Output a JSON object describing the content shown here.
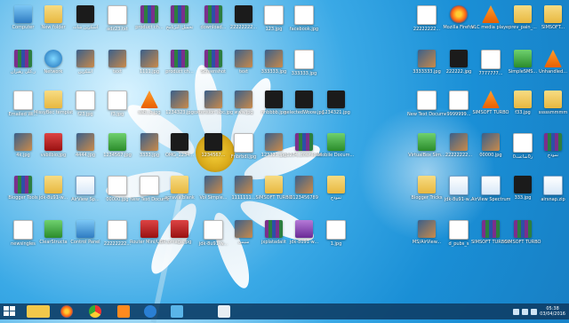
{
  "desktop": {
    "icons": [
      {
        "label": "Computer",
        "type": "t-pc"
      },
      {
        "label": "New folder",
        "type": "t-folder"
      },
      {
        "label": "اسکرین شات",
        "type": "t-dark"
      },
      {
        "label": "adz23.txt",
        "type": "t-txt"
      },
      {
        "label": "product ch...",
        "type": "t-rar"
      },
      {
        "label": "تحميل البرنامج",
        "type": "t-rar"
      },
      {
        "label": "download...",
        "type": "t-rar"
      },
      {
        "label": "22222222...",
        "type": "t-dark"
      },
      {
        "label": "123.jpg",
        "type": "t-txt"
      },
      {
        "label": "facebook.jpg",
        "type": "t-txt"
      },
      {
        "label": "22222222...",
        "type": "t-txt"
      },
      {
        "label": "Mozilla Firefox",
        "type": "t-ff"
      },
      {
        "label": "VLC media player",
        "type": "t-vlc"
      },
      {
        "label": "prev_pain_...",
        "type": "t-folder"
      },
      {
        "label": "SIMSOFT...",
        "type": "t-folder"
      },
      {
        "label": "ر.کلی رهبران",
        "type": "t-rar"
      },
      {
        "label": "Network",
        "type": "t-net"
      },
      {
        "label": "اسکرین",
        "type": "t-img"
      },
      {
        "label": "text",
        "type": "t-img"
      },
      {
        "label": "1111.jpg",
        "type": "t-img"
      },
      {
        "label": "product ch...",
        "type": "t-rar"
      },
      {
        "label": "Screenshot",
        "type": "t-rar"
      },
      {
        "label": "text",
        "type": "t-img"
      },
      {
        "label": "333333.jpg",
        "type": "t-img"
      },
      {
        "label": "333333.jpg",
        "type": "t-txt"
      },
      {
        "label": "3333333.jpg",
        "type": "t-img"
      },
      {
        "label": "222222.jpg",
        "type": "t-dark"
      },
      {
        "label": "7777777...",
        "type": "t-txt"
      },
      {
        "label": "SimpleSMS...",
        "type": "t-green"
      },
      {
        "label": "Unhandled...",
        "type": "t-vlc"
      },
      {
        "label": "Emailed Wi...",
        "type": "t-txt"
      },
      {
        "label": "MissyBec template",
        "type": "t-folder"
      },
      {
        "label": "f23.jpg",
        "type": "t-txt"
      },
      {
        "label": "f3.jpg",
        "type": "t-txt"
      },
      {
        "label": "sabi_b.jpg",
        "type": "t-vlc"
      },
      {
        "label": "1234323.jpg",
        "type": "t-img"
      },
      {
        "label": "oxtension abc.jpg",
        "type": "t-img"
      },
      {
        "label": "www.jpg",
        "type": "t-img"
      },
      {
        "label": "nnbbbb.jpg",
        "type": "t-dark"
      },
      {
        "label": "selectedWoow.jpg",
        "type": "t-dark"
      },
      {
        "label": "1234321.jpg",
        "type": "t-dark"
      },
      {
        "label": "New Text Document...",
        "type": "t-txt"
      },
      {
        "label": "9999999...",
        "type": "t-txt"
      },
      {
        "label": "SIMSOFT TURBO",
        "type": "t-vlc"
      },
      {
        "label": "f33.jpg",
        "type": "t-folder"
      },
      {
        "label": "sssssmmmm",
        "type": "t-folder"
      },
      {
        "label": "4k.jpg",
        "type": "t-img"
      },
      {
        "label": "vsbilbio.jpg",
        "type": "t-red"
      },
      {
        "label": "4444.jpg",
        "type": "t-img"
      },
      {
        "label": "1234567.jpg",
        "type": "t-green"
      },
      {
        "label": "3333.jpg",
        "type": "t-img"
      },
      {
        "label": "OMG_1234...",
        "type": "t-dark"
      },
      {
        "label": "1234567...",
        "type": "t-dark"
      },
      {
        "label": "Fnbrbdi.jpg",
        "type": "t-txt"
      },
      {
        "label": "123321.jpg",
        "type": "t-img"
      },
      {
        "label": "1234_download",
        "type": "t-rar"
      },
      {
        "label": "Mobile Docum...",
        "type": "t-green"
      },
      {
        "label": "VirtualBox Sim...",
        "type": "t-green"
      },
      {
        "label": "22222222...",
        "type": "t-img"
      },
      {
        "label": "00000.jpg",
        "type": "t-img"
      },
      {
        "label": "0ر0ساعت",
        "type": "t-txt"
      },
      {
        "label": "نموذج",
        "type": "t-rar"
      },
      {
        "label": "Blogger Tools",
        "type": "t-rar"
      },
      {
        "label": "jdk-8u91-w...",
        "type": "t-folder"
      },
      {
        "label": "AirView Sp...",
        "type": "t-java"
      },
      {
        "label": "00000.jpg",
        "type": "t-txt"
      },
      {
        "label": "New Text Docume...",
        "type": "t-txt"
      },
      {
        "label": "acravia.blank",
        "type": "t-folder"
      },
      {
        "label": "Vol Simple...",
        "type": "t-img"
      },
      {
        "label": "1111111...",
        "type": "t-img"
      },
      {
        "label": "SIMSOFT TURBO",
        "type": "t-folder"
      },
      {
        "label": "0123456789",
        "type": "t-img"
      },
      {
        "label": "نموذج",
        "type": "t-folder"
      },
      {
        "label": "Blogger Tricks",
        "type": "t-folder"
      },
      {
        "label": "jdk-8u91-w...",
        "type": "t-java"
      },
      {
        "label": "AirView Spectrum...",
        "type": "t-java"
      },
      {
        "label": "333.jpg",
        "type": "t-dark"
      },
      {
        "label": "airsnap.zip",
        "type": "t-java"
      },
      {
        "label": "newsingles",
        "type": "t-txt"
      },
      {
        "label": "ClearStructa",
        "type": "t-green"
      },
      {
        "label": "Control Panel",
        "type": "t-pc"
      },
      {
        "label": "22222222...",
        "type": "t-txt"
      },
      {
        "label": "Router Mini/UBR...",
        "type": "t-red"
      },
      {
        "label": "omaga.jpg",
        "type": "t-red"
      },
      {
        "label": "jdk-8u91-w...",
        "type": "t-txt"
      },
      {
        "label": "سیمی",
        "type": "t-img"
      },
      {
        "label": "jxplatadalit",
        "type": "t-rar"
      },
      {
        "label": "jdk-8u91-w...",
        "type": "t-purple"
      },
      {
        "label": "1.jpg",
        "type": "t-txt"
      },
      {
        "label": "MS/AirView...",
        "type": "t-img"
      },
      {
        "label": "d_pubs_s",
        "type": "t-txt"
      },
      {
        "label": "SIMSOFT TURBO SNAP",
        "type": "t-rar"
      },
      {
        "label": "SIMSOFT TURBO",
        "type": "t-rar"
      }
    ]
  },
  "taskbar": {
    "apps": [
      {
        "name": "file-explorer"
      },
      {
        "name": "firefox"
      },
      {
        "name": "chrome"
      },
      {
        "name": "vlc"
      },
      {
        "name": "teamviewer"
      },
      {
        "name": "photos"
      },
      {
        "name": "paint"
      }
    ],
    "clock": {
      "time": "05:38",
      "date": "03/04/2016"
    }
  }
}
